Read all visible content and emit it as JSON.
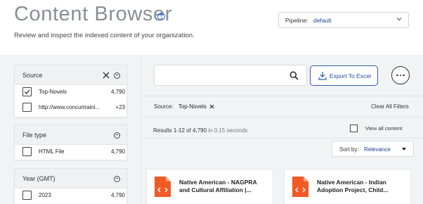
{
  "header": {
    "title": "Content Browser",
    "help_icon": "question-circle-icon",
    "subtitle": "Review and inspect the indexed content of your organization.",
    "pipeline_label": "Pipeline:",
    "pipeline_value": "default"
  },
  "facets": {
    "source": {
      "title": "Source",
      "items": [
        {
          "label": "Top-Novels",
          "count": "4,790",
          "checked": true
        },
        {
          "label": "http://www.concurtraini...",
          "count": "+23",
          "checked": false
        }
      ]
    },
    "file_type": {
      "title": "File type",
      "items": [
        {
          "label": "HTML File",
          "count": "4,790",
          "checked": false
        }
      ]
    },
    "year": {
      "title": "Year (GMT)",
      "items": [
        {
          "label": "2023",
          "count": "4,790",
          "checked": false
        }
      ]
    }
  },
  "search": {
    "placeholder": "",
    "value": ""
  },
  "toolbar": {
    "export_label": "Export To Excel"
  },
  "filters": {
    "source_label": "Source:",
    "source_chip": "Top-Novels",
    "clear_all": "Clear All Filters"
  },
  "results": {
    "summary_prefix": "Results 1-12 of 4,790",
    "summary_suffix": " in 0.15 seconds",
    "view_all_label": "View all content"
  },
  "sort": {
    "label": "Sort by:",
    "value": "Relevance"
  },
  "cards": [
    {
      "title": "Native American - NAGPRA and Cultural Affiliation |..."
    },
    {
      "title": "Native American - Indian Adoption Project, Child..."
    }
  ],
  "colors": {
    "accent": "#2b5fb3",
    "doc_icon": "#f15a24",
    "panel_bg": "#f2f3f5"
  }
}
